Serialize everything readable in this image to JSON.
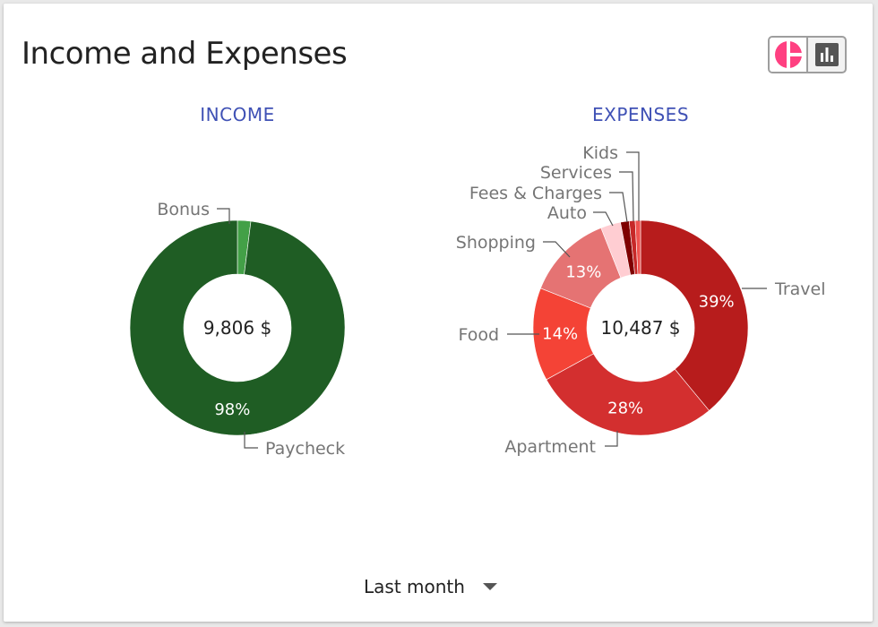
{
  "header": {
    "title": "Income and Expenses"
  },
  "view_toggle": {
    "options": [
      {
        "icon": "donut-chart-icon",
        "active": true,
        "color": "#ff4081"
      },
      {
        "icon": "bar-chart-icon",
        "active": false,
        "color": "#555555"
      }
    ]
  },
  "footer": {
    "period": "Last month"
  },
  "chart_data": [
    {
      "type": "pie",
      "title": "INCOME",
      "center_label": "9,806 $",
      "slices": [
        {
          "label": "Paycheck",
          "value": 98,
          "percent_label": "98%",
          "color": "#1f5d24"
        },
        {
          "label": "Bonus",
          "value": 2,
          "percent_label": "",
          "color": "#43a047"
        }
      ]
    },
    {
      "type": "pie",
      "title": "EXPENSES",
      "center_label": "10,487 $",
      "slices": [
        {
          "label": "Travel",
          "value": 39,
          "percent_label": "39%",
          "color": "#b71c1c"
        },
        {
          "label": "Apartment",
          "value": 28,
          "percent_label": "28%",
          "color": "#d32f2f"
        },
        {
          "label": "Food",
          "value": 14,
          "percent_label": "14%",
          "color": "#f44336"
        },
        {
          "label": "Shopping",
          "value": 13,
          "percent_label": "13%",
          "color": "#e57373"
        },
        {
          "label": "Auto",
          "value": 3,
          "percent_label": "",
          "color": "#ffcdd2"
        },
        {
          "label": "Fees & Charges",
          "value": 1.3,
          "percent_label": "",
          "color": "#7f0000"
        },
        {
          "label": "Services",
          "value": 0.9,
          "percent_label": "",
          "color": "#c62828"
        },
        {
          "label": "Kids",
          "value": 0.8,
          "percent_label": "",
          "color": "#ef5350"
        }
      ]
    }
  ]
}
